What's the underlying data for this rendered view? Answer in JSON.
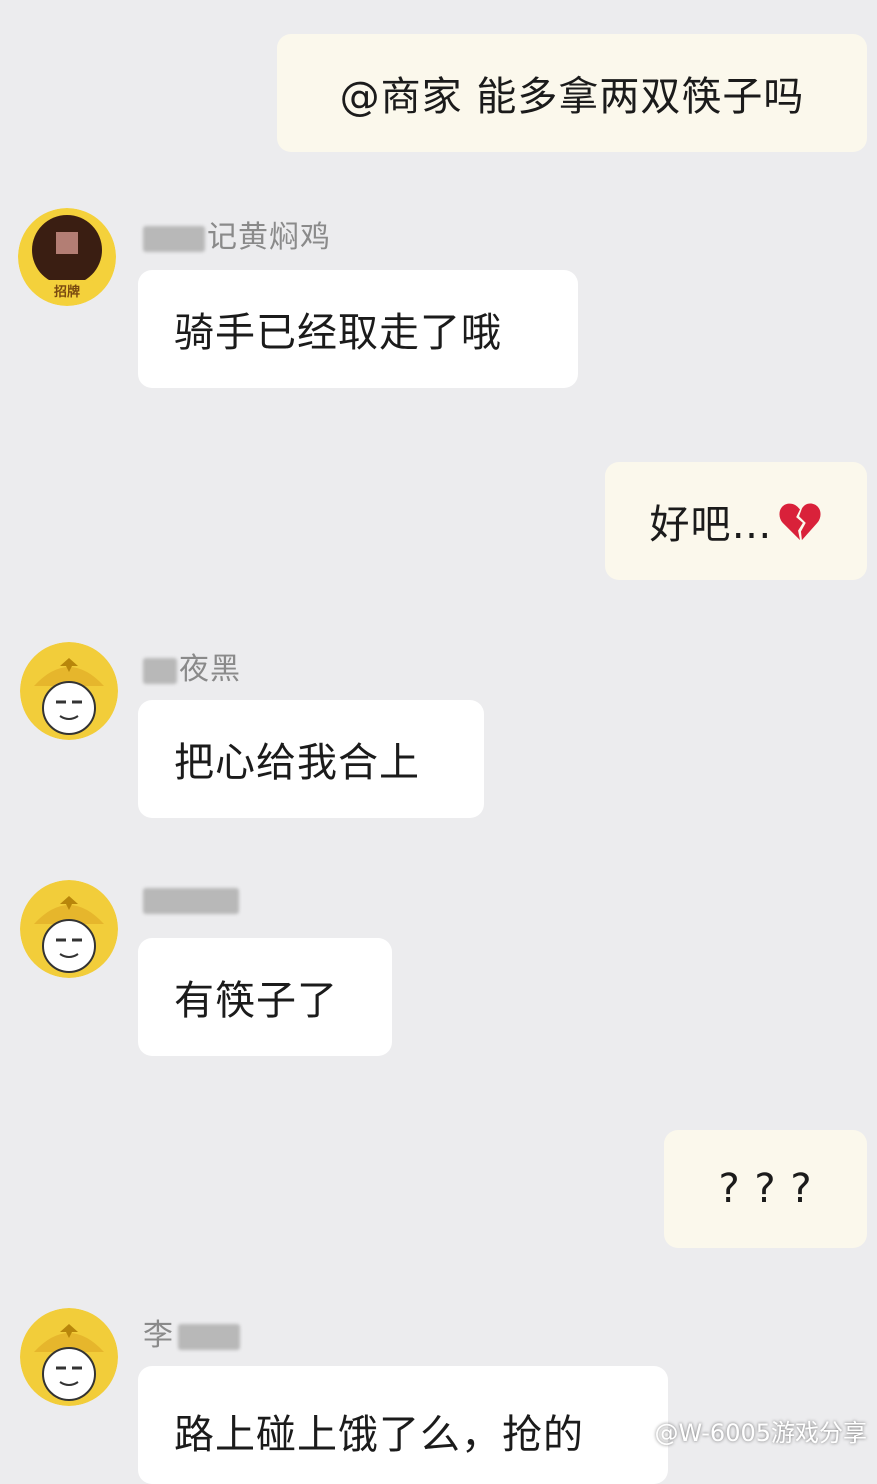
{
  "colors": {
    "background": "#ececee",
    "outgoing_bubble": "#fbf8ec",
    "incoming_bubble": "#ffffff",
    "rider_avatar_bg": "#f2cd3a",
    "merchant_avatar_ring": "#f4d13b",
    "heart": "#d9213a"
  },
  "messages": [
    {
      "direction": "outgoing",
      "text": "@商家 能多拿两双筷子吗"
    },
    {
      "direction": "incoming",
      "sender": "记黄焖鸡",
      "avatar": "merchant-avatar",
      "avatar_caption": "招牌",
      "text": "骑手已经取走了哦"
    },
    {
      "direction": "outgoing",
      "text": "好吧…",
      "icon": "broken-heart-icon"
    },
    {
      "direction": "incoming",
      "sender": "夜黑",
      "avatar": "rider-avatar",
      "text": "把心给我合上"
    },
    {
      "direction": "incoming",
      "sender": "",
      "avatar": "rider-avatar",
      "text": "有筷子了"
    },
    {
      "direction": "outgoing",
      "text": "? ? ?"
    },
    {
      "direction": "incoming",
      "sender": "李",
      "avatar": "rider-avatar",
      "text": "路上碰上饿了么，抢的"
    }
  ],
  "watermark": {
    "icon": "weibo-icon",
    "text": "@W-6005游戏分享"
  }
}
